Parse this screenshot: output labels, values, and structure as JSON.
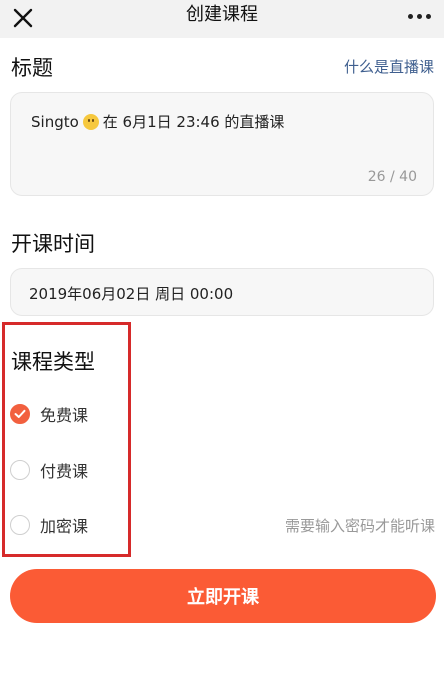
{
  "header": {
    "title": "创建课程"
  },
  "title_section": {
    "label": "标题",
    "help_link": "什么是直播课",
    "value_prefix": "Singto",
    "value_suffix": "在 6月1日 23:46 的直播课",
    "char_count": "26 / 40"
  },
  "time_section": {
    "label": "开课时间",
    "value": "2019年06月02日 周日 00:00"
  },
  "type_section": {
    "label": "课程类型",
    "options": [
      {
        "label": "免费课",
        "selected": true
      },
      {
        "label": "付费课",
        "selected": false
      },
      {
        "label": "加密课",
        "selected": false
      }
    ],
    "password_hint": "需要输入密码才能听课"
  },
  "submit": {
    "label": "立即开课"
  },
  "colors": {
    "accent": "#fb5b35",
    "radio_checked": "#f2603f",
    "link": "#3f5f8f",
    "highlight_box": "#d62a2a"
  }
}
